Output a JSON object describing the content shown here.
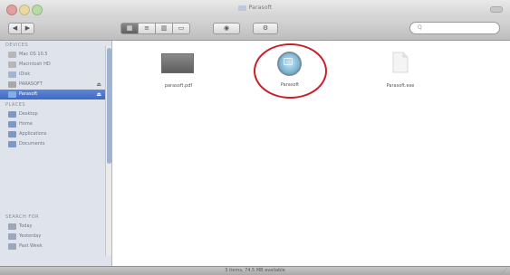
{
  "window": {
    "title": "Parasoft"
  },
  "toolbar": {
    "back_icon": "◀",
    "forward_icon": "▶",
    "view_icons": [
      "▦",
      "≡",
      "▥",
      "▭"
    ],
    "eye_icon": "◉",
    "action_icon": "⚙",
    "search_placeholder": "Q"
  },
  "sidebar": {
    "sections": [
      {
        "label": "DEVICES"
      },
      {
        "label": "PLACES"
      },
      {
        "label": "SEARCH FOR"
      }
    ],
    "items": [
      {
        "label": "Mac OS 10.5",
        "color": "#b7b7b7",
        "selected": false,
        "badge": ""
      },
      {
        "label": "Macintosh HD",
        "color": "#b7b7b7",
        "selected": false,
        "badge": ""
      },
      {
        "label": "iDisk",
        "color": "#9fb5d8",
        "selected": false,
        "badge": ""
      },
      {
        "label": "PARASOFT",
        "color": "#a8a8a8",
        "selected": false,
        "badge": "⏏"
      },
      {
        "label": "Parasoft",
        "color": "#7fb0e0",
        "selected": true,
        "badge": "⏏"
      },
      {
        "label": "Desktop",
        "color": "#7c97c8",
        "selected": false,
        "badge": ""
      },
      {
        "label": "Home",
        "color": "#7c97c8",
        "selected": false,
        "badge": ""
      },
      {
        "label": "Applications",
        "color": "#7c97c8",
        "selected": false,
        "badge": ""
      },
      {
        "label": "Documents",
        "color": "#7c97c8",
        "selected": false,
        "badge": ""
      },
      {
        "label": "Today",
        "color": "#9aa7bd",
        "selected": false,
        "badge": ""
      },
      {
        "label": "Yesterday",
        "color": "#9aa7bd",
        "selected": false,
        "badge": ""
      },
      {
        "label": "Past Week",
        "color": "#9aa7bd",
        "selected": false,
        "badge": ""
      }
    ]
  },
  "content": {
    "files": [
      {
        "name": "parasoft.pdf",
        "kind": "pdf-icon"
      },
      {
        "name": "Parasoft",
        "kind": "app-icon",
        "highlighted": true
      },
      {
        "name": "Parasoft.exe",
        "kind": "document-icon"
      }
    ]
  },
  "highlight_color": "#c8202a",
  "status": {
    "text": "3 items, 74.5 MB available"
  }
}
